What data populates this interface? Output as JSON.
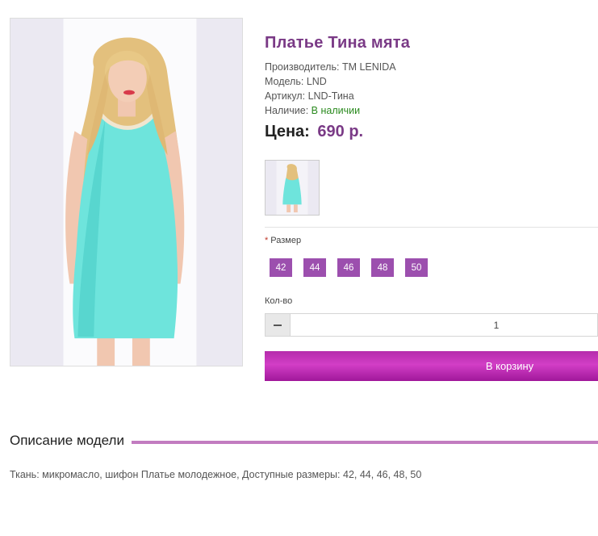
{
  "product": {
    "title": "Платье Тина мята",
    "manufacturer_label": "Производитель:",
    "manufacturer": "TM LENIDA",
    "model_label": "Модель:",
    "model": "LND",
    "sku_label": "Артикул:",
    "sku": "LND-Тина",
    "availability_label": "Наличие:",
    "availability": "В наличии",
    "price_label": "Цена:",
    "price": "690 р."
  },
  "options": {
    "required_mark": "*",
    "size_label": "Размер",
    "sizes": [
      "42",
      "44",
      "46",
      "48",
      "50"
    ],
    "quantity_label": "Кол-во",
    "quantity": "1"
  },
  "actions": {
    "add_to_cart": "В корзину"
  },
  "description": {
    "heading": "Описание модели",
    "text": "Ткань: микромасло, шифон Платье молодежное, Доступные размеры: 42, 44, 46, 48, 50"
  },
  "colors": {
    "title": "#7a3a86",
    "size_button": "#9c4fae",
    "in_stock": "#2a8a1e",
    "cart_button": "#c233b8",
    "dress": "#6ee4dc"
  }
}
